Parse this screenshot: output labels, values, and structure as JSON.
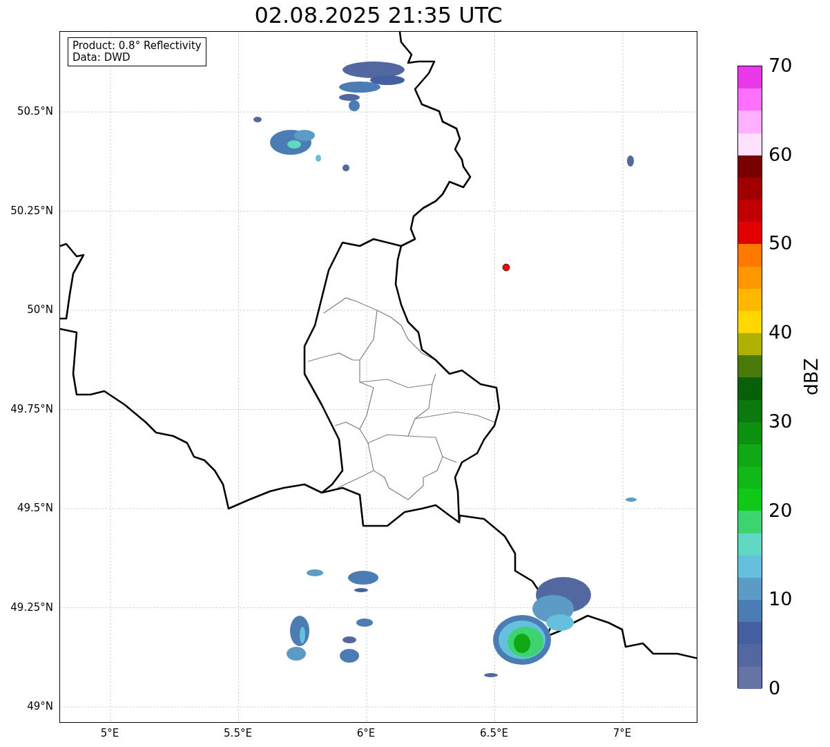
{
  "title": "02.08.2025 21:35 UTC",
  "info_box": {
    "lines": [
      "Product: 0.8° Reflectivity",
      "Data: DWD"
    ]
  },
  "map": {
    "yticks": [
      "50.5°N",
      "50.25°N",
      "50°N",
      "49.75°N",
      "49.5°N",
      "49.25°N",
      "49°N"
    ],
    "xticks": [
      "5°E",
      "5.5°E",
      "6°E",
      "6.5°E",
      "7°E"
    ]
  },
  "colorbar": {
    "label": "dBZ",
    "ticks": [
      "70",
      "60",
      "50",
      "40",
      "30",
      "20",
      "10",
      "0"
    ],
    "segments": [
      {
        "color": "#e838e8"
      },
      {
        "color": "#ff70ff"
      },
      {
        "color": "#ffb0ff"
      },
      {
        "color": "#ffe0ff"
      },
      {
        "color": "#780000"
      },
      {
        "color": "#a00000"
      },
      {
        "color": "#c00000"
      },
      {
        "color": "#e00000"
      },
      {
        "color": "#ff7800"
      },
      {
        "color": "#ff9800"
      },
      {
        "color": "#ffb800"
      },
      {
        "color": "#ffd800"
      },
      {
        "color": "#b0b000"
      },
      {
        "color": "#4a7a0a"
      },
      {
        "color": "#086008"
      },
      {
        "color": "#0c7810"
      },
      {
        "color": "#0c9010"
      },
      {
        "color": "#10a814"
      },
      {
        "color": "#10b818"
      },
      {
        "color": "#10c818"
      },
      {
        "color": "#3cd470"
      },
      {
        "color": "#60d8c4"
      },
      {
        "color": "#64c0dc"
      },
      {
        "color": "#5c9cc4"
      },
      {
        "color": "#4c7cb4"
      },
      {
        "color": "#4460a0"
      },
      {
        "color": "#5468a0"
      },
      {
        "color": "#6474a4"
      }
    ]
  }
}
